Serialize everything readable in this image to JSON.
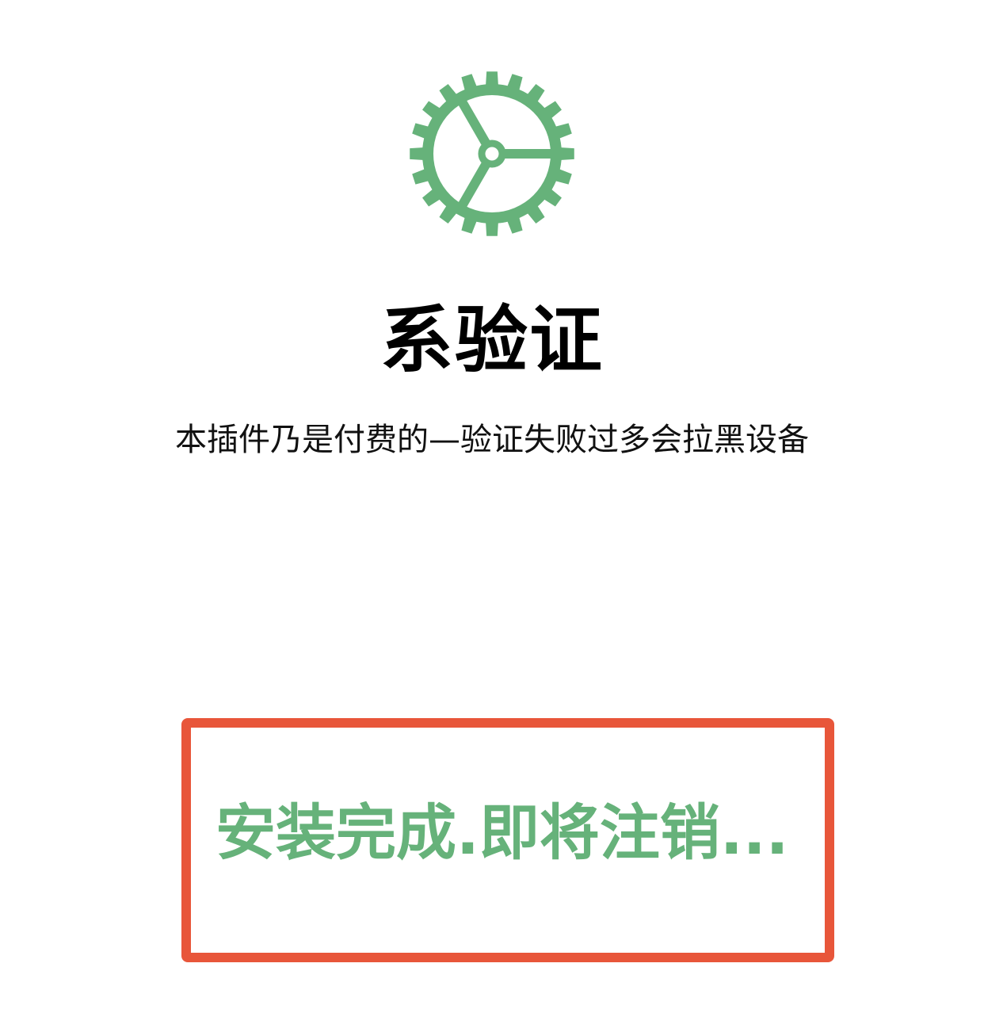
{
  "colors": {
    "accent_green": "#66b27a",
    "highlight_red": "#e8563a",
    "text_dark": "#000000"
  },
  "icon": {
    "name": "gear-icon"
  },
  "header": {
    "title": "系验证",
    "subtitle": "本插件乃是付费的—验证失败过多会拉黑设备"
  },
  "status": {
    "message": "安装完成.即将注销..."
  }
}
